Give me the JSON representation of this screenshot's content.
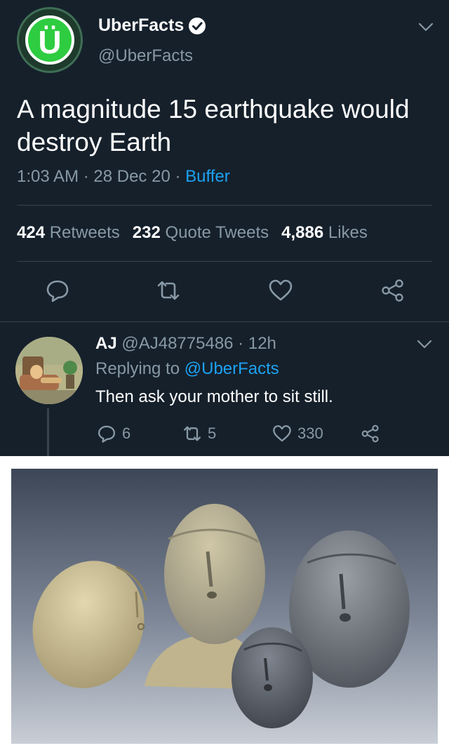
{
  "main_tweet": {
    "display_name": "UberFacts",
    "handle": "@UberFacts",
    "avatar_letter": "Ü",
    "text": "A magnitude 15 earthquake would destroy Earth",
    "time": "1:03 AM",
    "date": "28 Dec 20",
    "source": "Buffer",
    "separator": " · ",
    "retweets_count": "424",
    "retweets_label": "Retweets",
    "quote_count": "232",
    "quote_label": "Quote Tweets",
    "likes_count": "4,886",
    "likes_label": "Likes"
  },
  "reply": {
    "name": "AJ",
    "handle": "@AJ48775486",
    "time": "12h",
    "replying_prefix": "Replying to",
    "replying_to": "@UberFacts",
    "text": "Then ask your mother to sit still.",
    "reply_count": "6",
    "retweet_count": "5",
    "like_count": "330"
  },
  "icons": {
    "verified": "verified-badge-icon",
    "menu": "chevron-down-icon",
    "reply": "speech-bubble-icon",
    "retweet": "retweet-arrows-icon",
    "like": "heart-icon",
    "share": "share-nodes-icon"
  },
  "colors": {
    "background": "#15202b",
    "text_primary": "#ffffff",
    "text_secondary": "#8899a6",
    "accent": "#1da1f2",
    "divider": "#38444d",
    "brand_green": "#2ecc40"
  }
}
